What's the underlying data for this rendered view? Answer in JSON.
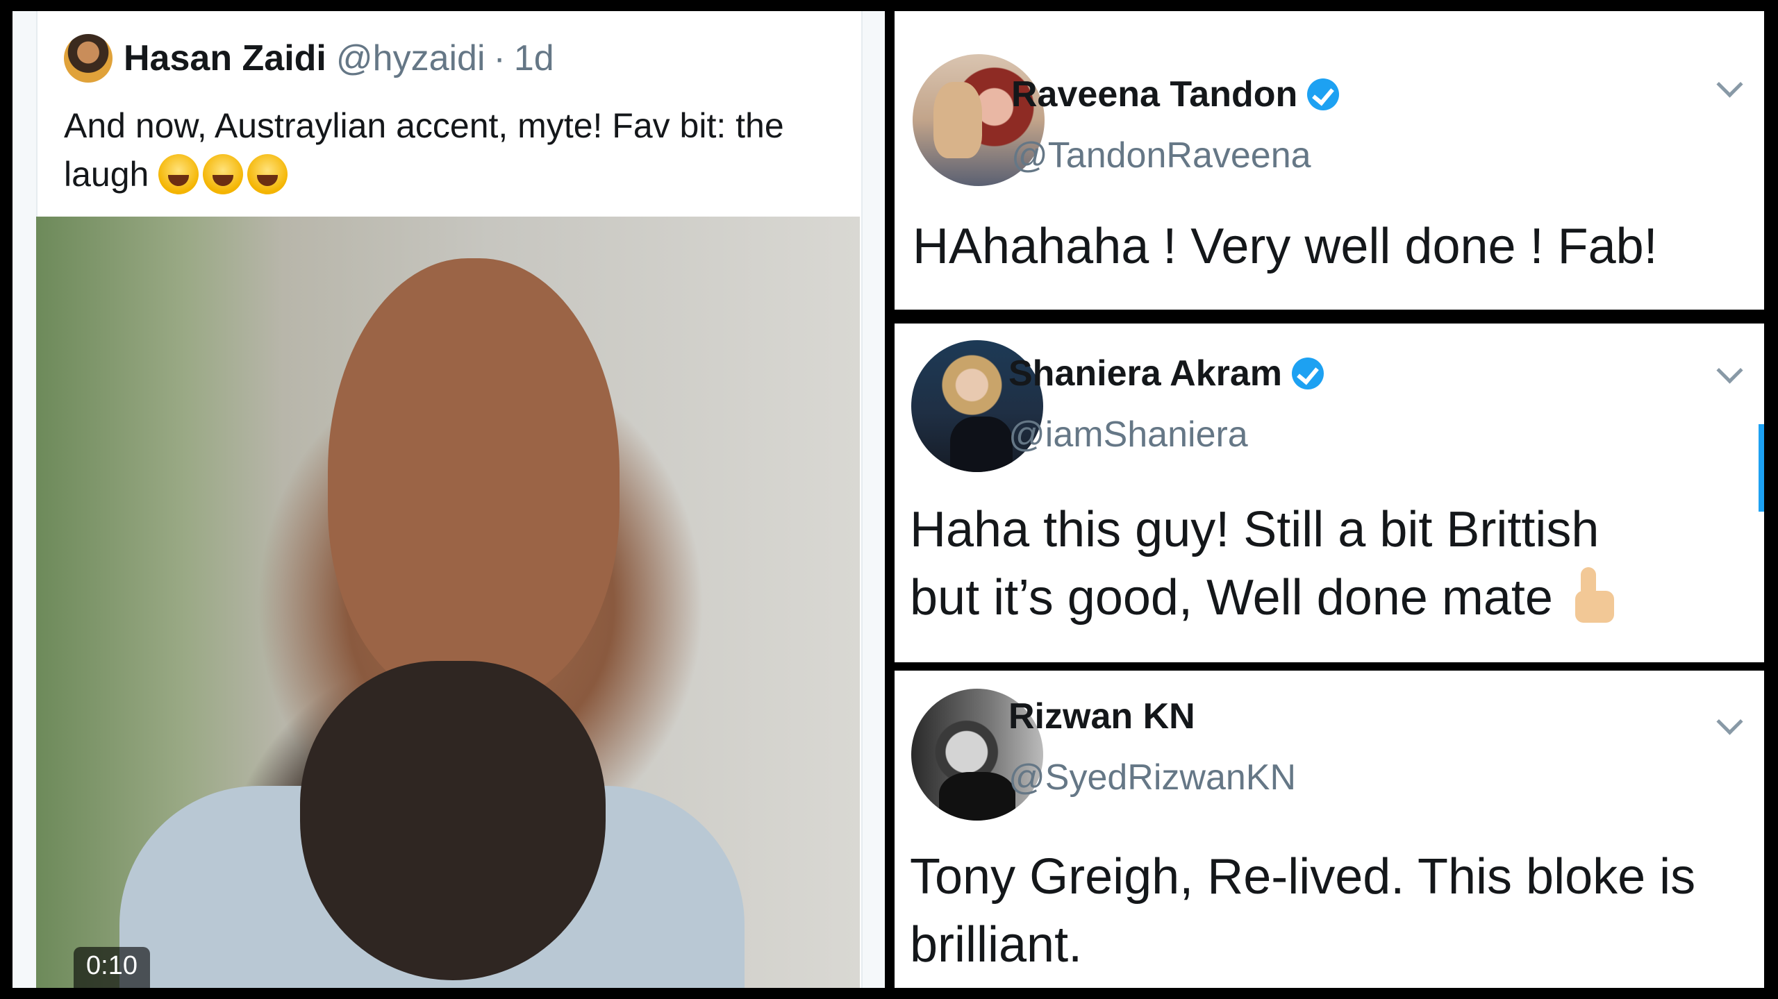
{
  "original_tweet": {
    "name": "Hasan Zaidi",
    "handle": "@hyzaidi",
    "separator": "·",
    "time": "1d",
    "text": "And now, Austraylian accent, myte! Fav bit: the laugh",
    "emoji": [
      "face-with-tears-of-joy",
      "face-with-tears-of-joy",
      "face-with-tears-of-joy"
    ],
    "video_duration": "0:10"
  },
  "replies": [
    {
      "name": "Raveena Tandon",
      "verified": true,
      "handle": "@TandonRaveena",
      "text": "HAhahaha ! Very well done ! Fab!"
    },
    {
      "name": "Shaniera Akram",
      "verified": true,
      "handle": "@iamShaniera",
      "text_line1": "Haha this guy! Still a bit Brittish",
      "text_line2": "but it’s good, Well done mate",
      "emoji": "thumbs-up"
    },
    {
      "name": "Rizwan KN",
      "verified": false,
      "handle": "@SyedRizwanKN",
      "text_line1": "Tony Greigh, Re-lived. This bloke is",
      "text_line2": "brilliant."
    }
  ],
  "colors": {
    "verified_blue": "#1da1f2",
    "handle_grey": "#657786",
    "text_dark": "#14171a"
  }
}
